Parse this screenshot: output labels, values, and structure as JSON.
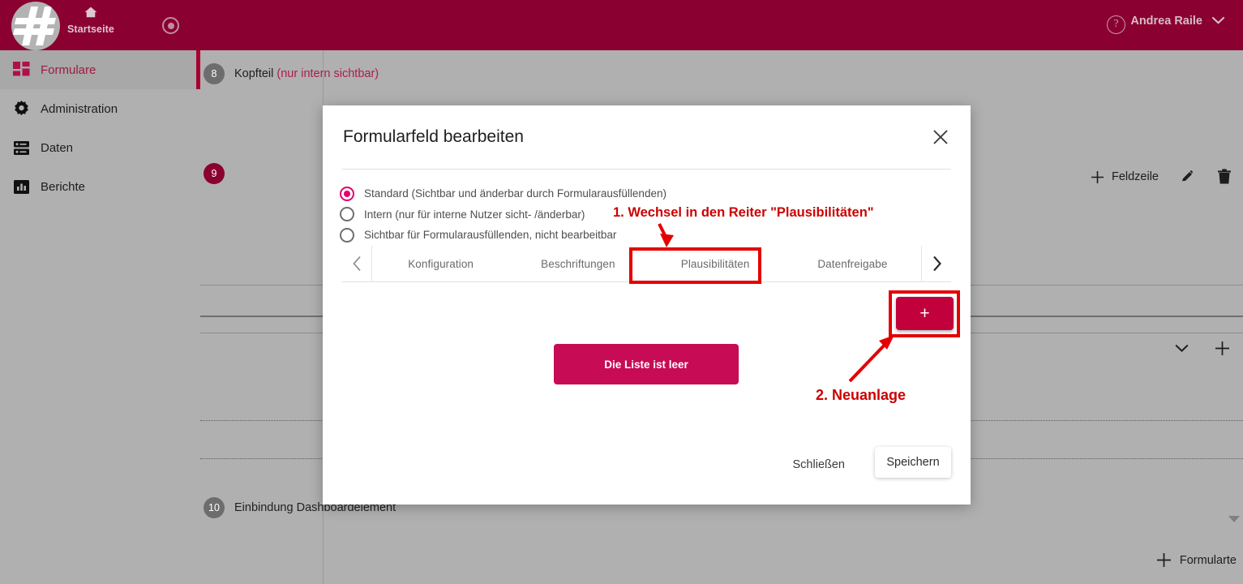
{
  "header": {
    "home_label": "Startseite",
    "home_icon": "home-icon",
    "record_icon": "record-icon",
    "help_icon": "help-icon",
    "user_name": "Andrea Raile",
    "chevron_icon": "chevron-down-icon",
    "brand_color": "#8a0030"
  },
  "sidebar": {
    "items": [
      {
        "label": "Formulare",
        "icon": "grid-icon",
        "active": true
      },
      {
        "label": "Administration",
        "icon": "gear-icon",
        "active": false
      },
      {
        "label": "Daten",
        "icon": "database-icon",
        "active": false
      },
      {
        "label": "Berichte",
        "icon": "bar-chart-icon",
        "active": false
      }
    ]
  },
  "background": {
    "steps": [
      {
        "number": "8",
        "title": "Kopfteil",
        "note": "(nur intern sichtbar)"
      },
      {
        "number": "9",
        "title": "",
        "note": ""
      },
      {
        "number": "10",
        "title": "Einbindung Dashboardelement",
        "note": ""
      }
    ],
    "row_actions": {
      "add_label": "Feldzeile",
      "add_icon": "plus-icon",
      "edit_icon": "pencil-icon",
      "delete_icon": "trash-icon"
    },
    "row_controls": {
      "expand_icon": "chevron-down-icon",
      "add_icon": "plus-icon"
    },
    "bottom_add": {
      "label": "Formularte",
      "icon": "plus-icon"
    }
  },
  "modal": {
    "title": "Formularfeld bearbeiten",
    "close_icon": "close-icon",
    "radios": [
      {
        "label": "Standard (Sichtbar und änderbar durch Formularausfüllenden)",
        "checked": true
      },
      {
        "label": "Intern (nur für interne Nutzer sicht- /änderbar)",
        "checked": false
      },
      {
        "label": "Sichtbar für Formularausfüllenden, nicht bearbeitbar",
        "checked": false
      }
    ],
    "tabs": {
      "prev_icon": "chevron-left-icon",
      "next_icon": "chevron-right-icon",
      "items": [
        {
          "label": "Konfiguration",
          "selected": false
        },
        {
          "label": "Beschriftungen",
          "selected": false
        },
        {
          "label": "Plausibilitäten",
          "selected": true
        },
        {
          "label": "Datenfreigabe",
          "selected": false
        }
      ]
    },
    "add_button": {
      "label": "+",
      "icon": "plus-icon",
      "color": "#c2003c"
    },
    "empty_list_label": "Die Liste ist leer",
    "empty_list_color": "#c70b54",
    "footer": {
      "close_label": "Schließen",
      "save_label": "Speichern"
    }
  },
  "annotations": {
    "color": "#cc0000",
    "items": [
      {
        "text": "1. Wechsel in den Reiter \"Plausibilitäten\"",
        "target": "plausibilitaeten-tab"
      },
      {
        "text": "2. Neuanlage",
        "target": "add-plausibility-button"
      }
    ]
  }
}
